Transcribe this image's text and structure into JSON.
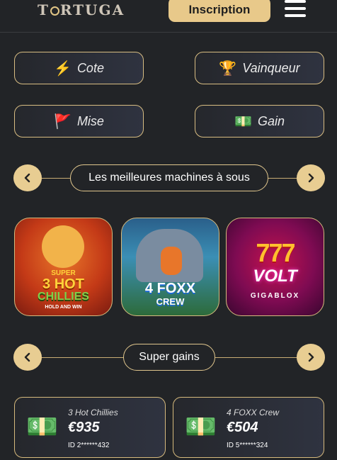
{
  "header": {
    "logo": "TORTUGA",
    "signup_label": "Inscription"
  },
  "filters": [
    {
      "label": "Cote",
      "icon": "lightning-icon"
    },
    {
      "label": "Vainqueur",
      "icon": "trophy-icon"
    },
    {
      "label": "Mise",
      "icon": "flag-icon"
    },
    {
      "label": "Gain",
      "icon": "cash-icon"
    }
  ],
  "sections": {
    "slots_title": "Les meilleures machines à sous",
    "wins_title": "Super gains"
  },
  "games": [
    {
      "title_line1": "SUPER",
      "title_line2": "3 HOT",
      "title_line3": "CHILLIES",
      "subtitle": "HOLD AND WIN"
    },
    {
      "title_line1": "4 FOXX",
      "title_line2": "CREW"
    },
    {
      "title_line1": "777",
      "title_line2": "VOLT",
      "subtitle": "GIGABLOX"
    }
  ],
  "wins": [
    {
      "game": "3 Hot Chillies",
      "amount": "€935",
      "user_id": "ID 2******432"
    },
    {
      "game": "4 FOXX Crew",
      "amount": "€504",
      "user_id": "ID 5******324"
    }
  ],
  "colors": {
    "accent": "#e8c98a",
    "background": "#222427"
  }
}
